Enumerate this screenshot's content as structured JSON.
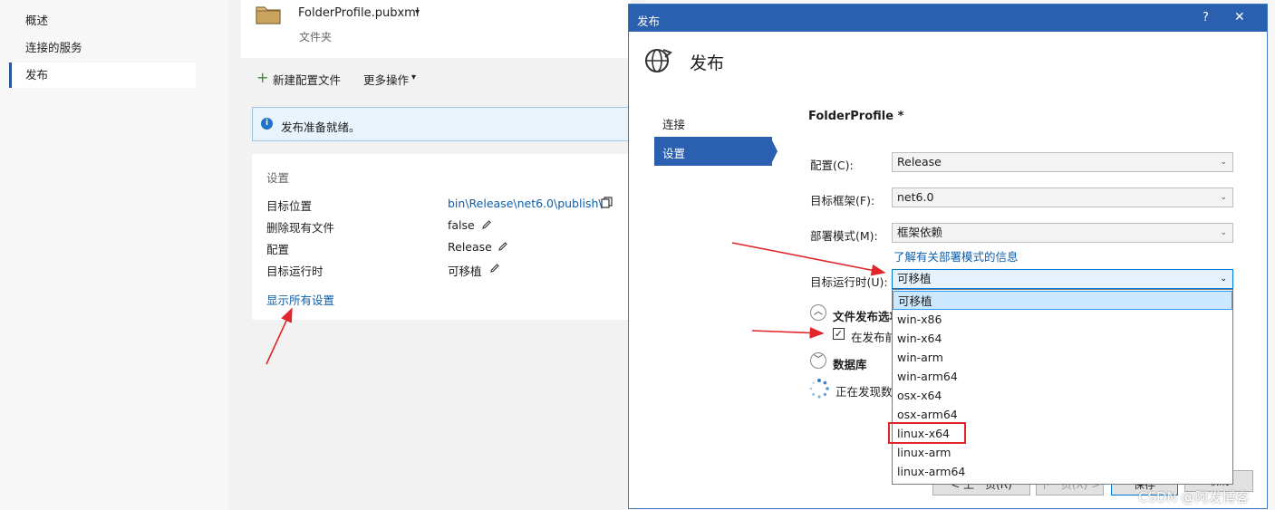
{
  "left_nav": {
    "items": [
      {
        "label": "概述",
        "active": false
      },
      {
        "label": "连接的服务",
        "active": false
      },
      {
        "label": "发布",
        "active": true
      }
    ]
  },
  "profile": {
    "name": "FolderProfile.pubxml",
    "caret": "▾",
    "type": "文件夹"
  },
  "actions": {
    "new_profile": "新建配置文件",
    "more_actions": "更多操作",
    "more_caret": "▾"
  },
  "info_bar": {
    "icon": "info-icon",
    "text": "发布准备就绪。"
  },
  "settings": {
    "header": "设置",
    "rows": [
      {
        "label": "目标位置",
        "value": "bin\\Release\\net6.0\\publish\\",
        "link": true
      },
      {
        "label": "删除现有文件",
        "value": "false"
      },
      {
        "label": "配置",
        "value": "Release"
      },
      {
        "label": "目标运行时",
        "value": "可移植"
      }
    ],
    "show_all": "显示所有设置"
  },
  "dialog": {
    "title": "发布",
    "help": "?",
    "close": "✕",
    "heading": "发布",
    "nav": [
      {
        "label": "连接",
        "active": false
      },
      {
        "label": "设置",
        "active": true
      }
    ],
    "profile_title": "FolderProfile *",
    "fields": {
      "config_label": "配置(C):",
      "config_value": "Release",
      "framework_label": "目标框架(F):",
      "framework_value": "net6.0",
      "deploy_label": "部署模式(M):",
      "deploy_value": "框架依赖",
      "deploy_link": "了解有关部署模式的信息",
      "runtime_label": "目标运行时(U):",
      "runtime_value": "可移植"
    },
    "runtime_options": [
      "可移植",
      "win-x86",
      "win-x64",
      "win-arm",
      "win-arm64",
      "osx-x64",
      "osx-arm64",
      "linux-x64",
      "linux-arm",
      "linux-arm64"
    ],
    "sections": {
      "file_publish": "文件发布选项",
      "checkbox_text": "在发布前",
      "database": "数据库",
      "discovering": "正在发现数"
    },
    "buttons": {
      "prev": "< 上一页(R)",
      "next": "下一页(X) >",
      "save": "保存",
      "cancel": "取消"
    }
  },
  "watermark": "CSDN @阿发博客",
  "colors": {
    "accent": "#2b5fb0",
    "highlight": "#cce8ff",
    "annotation_red": "#e0262b"
  }
}
